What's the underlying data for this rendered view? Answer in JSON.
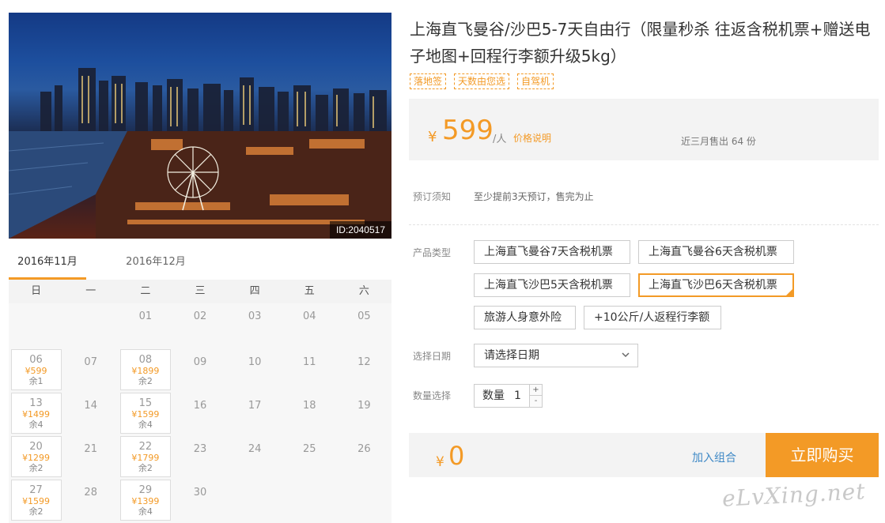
{
  "photo": {
    "id_label": "ID:2040517"
  },
  "calendar": {
    "tabs": [
      "2016年11月",
      "2016年12月"
    ],
    "weekdays": [
      "日",
      "一",
      "二",
      "三",
      "四",
      "五",
      "六"
    ],
    "rows": [
      [
        {
          "d": ""
        },
        {
          "d": ""
        },
        {
          "d": "01"
        },
        {
          "d": "02"
        },
        {
          "d": "03"
        },
        {
          "d": "04"
        },
        {
          "d": "05"
        }
      ],
      [
        {
          "d": "06",
          "p": "¥599",
          "r": "余1"
        },
        {
          "d": "07"
        },
        {
          "d": "08",
          "p": "¥1899",
          "r": "余2"
        },
        {
          "d": "09"
        },
        {
          "d": "10"
        },
        {
          "d": "11"
        },
        {
          "d": "12"
        }
      ],
      [
        {
          "d": "13",
          "p": "¥1499",
          "r": "余4"
        },
        {
          "d": "14"
        },
        {
          "d": "15",
          "p": "¥1599",
          "r": "余4"
        },
        {
          "d": "16"
        },
        {
          "d": "17"
        },
        {
          "d": "18"
        },
        {
          "d": "19"
        }
      ],
      [
        {
          "d": "20",
          "p": "¥1299",
          "r": "余2"
        },
        {
          "d": "21"
        },
        {
          "d": "22",
          "p": "¥1799",
          "r": "余2"
        },
        {
          "d": "23"
        },
        {
          "d": "24"
        },
        {
          "d": "25"
        },
        {
          "d": "26"
        }
      ],
      [
        {
          "d": "27",
          "p": "¥1599",
          "r": "余2"
        },
        {
          "d": "28"
        },
        {
          "d": "29",
          "p": "¥1399",
          "r": "余4"
        },
        {
          "d": "30"
        },
        {
          "d": ""
        },
        {
          "d": ""
        },
        {
          "d": ""
        }
      ]
    ]
  },
  "product": {
    "title": "上海直飞曼谷/沙巴5-7天自由行（限量秒杀 往返含税机票+赠送电子地图+回程行李额升级5kg）",
    "tags": [
      "落地签",
      "天数由您选",
      "自驾机"
    ],
    "currency": "¥",
    "price": "599",
    "unit": "/人",
    "price_note": "价格说明",
    "sold": "近三月售出 64 份"
  },
  "booking": {
    "notice_label": "预订须知",
    "notice_text": "至少提前3天预订，售完为止",
    "type_label": "产品类型",
    "options": [
      {
        "label": "上海直飞曼谷7天含税机票",
        "selected": false
      },
      {
        "label": "上海直飞曼谷6天含税机票",
        "selected": false
      },
      {
        "label": "上海直飞沙巴5天含税机票",
        "selected": false
      },
      {
        "label": "上海直飞沙巴6天含税机票",
        "selected": true
      },
      {
        "label": "旅游人身意外险",
        "selected": false
      },
      {
        "label": "+10公斤/人返程行李额",
        "selected": false
      }
    ],
    "date_label": "选择日期",
    "date_placeholder": "请选择日期",
    "qty_label": "数量选择",
    "qty_inner_label": "数量",
    "qty_value": "1",
    "step_up": "+",
    "step_down": "-"
  },
  "checkout": {
    "currency": "¥",
    "total": "0",
    "combo_link": "加入组合",
    "buy_button": "立即购买"
  },
  "watermark": "eLvXing.net",
  "colors": {
    "accent": "#f39a26",
    "link": "#3f89c6",
    "panel": "#f3f3f3"
  }
}
